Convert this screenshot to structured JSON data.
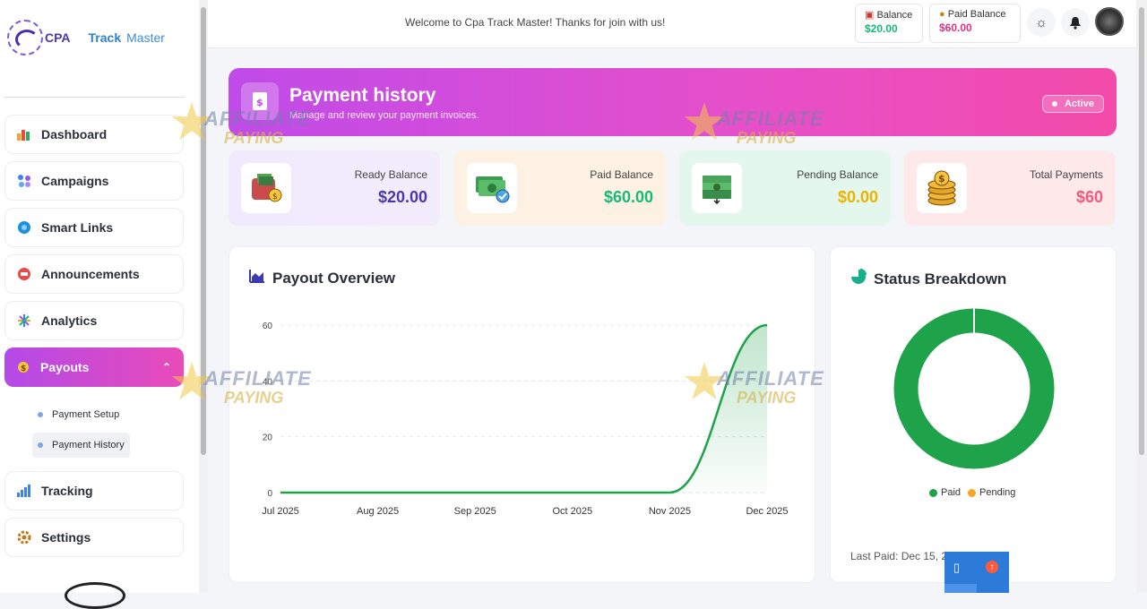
{
  "brand": {
    "cpa": "CPA",
    "track": "Track",
    "master": "Master"
  },
  "topbar": {
    "welcome": "Welcome to Cpa Track Master! Thanks for join with us!",
    "balance_label": "Balance",
    "balance_value": "$20.00",
    "paid_label": "Paid Balance",
    "paid_value": "$60.00"
  },
  "sidebar": {
    "items": [
      {
        "label": "Dashboard",
        "icon": "dashboard-icon"
      },
      {
        "label": "Campaigns",
        "icon": "campaigns-icon"
      },
      {
        "label": "Smart Links",
        "icon": "globe-icon"
      },
      {
        "label": "Announcements",
        "icon": "megaphone-icon"
      },
      {
        "label": "Analytics",
        "icon": "analytics-icon"
      },
      {
        "label": "Payouts",
        "icon": "payout-icon"
      },
      {
        "label": "Tracking",
        "icon": "bar-chart-icon"
      },
      {
        "label": "Settings",
        "icon": "gear-icon"
      }
    ],
    "sub_items": [
      {
        "label": "Payment Setup"
      },
      {
        "label": "Payment History"
      }
    ]
  },
  "hero": {
    "title": "Payment history",
    "subtitle": "Manage and review your payment invoices.",
    "badge": "Active"
  },
  "stats": [
    {
      "label": "Ready Balance",
      "value": "$20.00",
      "color": "#4a3aa8",
      "icon": "wallet-icon"
    },
    {
      "label": "Paid Balance",
      "value": "$60.00",
      "color": "#17b978",
      "icon": "cash-check-icon"
    },
    {
      "label": "Pending Balance",
      "value": "$0.00",
      "color": "#e8b400",
      "icon": "cash-stack-icon"
    },
    {
      "label": "Total Payments",
      "value": "$60",
      "color": "#ef5b7a",
      "icon": "coins-icon"
    }
  ],
  "payout_card": {
    "title": "Payout Overview"
  },
  "status_card": {
    "title": "Status Breakdown",
    "last_paid": "Last Paid: Dec 15, 2025"
  },
  "watermark": {
    "line1": "AFFILIATE",
    "line2": "PAYING"
  },
  "chart_data": [
    {
      "type": "area",
      "title": "Payout Overview",
      "categories": [
        "Jul 2025",
        "Aug 2025",
        "Sep 2025",
        "Oct 2025",
        "Nov 2025",
        "Dec 2025"
      ],
      "series": [
        {
          "values": [
            0,
            0,
            0,
            0,
            0,
            60
          ]
        }
      ],
      "ylim": [
        0,
        60
      ],
      "yticks": [
        0,
        20,
        40,
        60
      ],
      "grid": true,
      "color": "#1ea34a"
    },
    {
      "type": "pie",
      "title": "Status Breakdown",
      "series": [
        {
          "name": "Paid",
          "value": 60,
          "color": "#1ea34a"
        },
        {
          "name": "Pending",
          "value": 0,
          "color": "#f5a623"
        }
      ],
      "legend": "bottom"
    }
  ]
}
